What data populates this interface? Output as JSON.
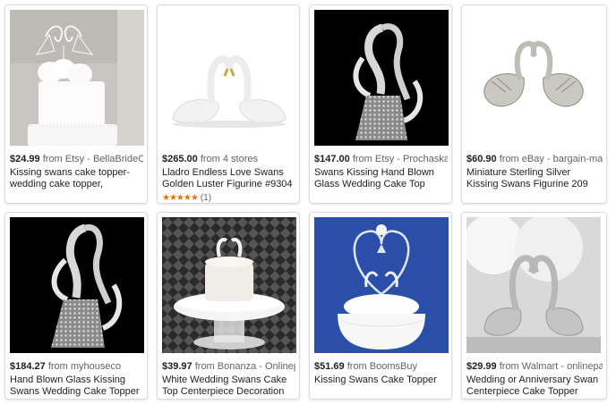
{
  "products": [
    {
      "price": "$24.99",
      "from": "from Etsy - BellaBrideCreations",
      "title": "Kissing swans cake topper- wedding cake topper, geometric wedding ...",
      "image": "cake-with-swan-topper-image"
    },
    {
      "price": "$265.00",
      "from": "from 4 stores",
      "title": "Lladro Endless Love Swans Golden Luster Figurine #9304",
      "stars": "★★★★★",
      "rating_count": "(1)",
      "image": "porcelain-swans-figurine-image"
    },
    {
      "price": "$147.00",
      "from": "from Etsy - ProchaskaGallery",
      "title": "Swans Kissing Hand Blown Glass Wedding Cake Top Topper",
      "image": "glass-swans-topper-image"
    },
    {
      "price": "$60.90",
      "from": "from eBay - bargain-market",
      "title": "Miniature Sterling Silver Kissing Swans Figurine 209",
      "image": "silver-swans-figurine-image"
    },
    {
      "price": "$184.27",
      "from": "from myhouseco",
      "title": "Hand Blown Glass Kissing Swans Wedding Cake Topper",
      "image": "glass-swans-topper-image"
    },
    {
      "price": "$39.97",
      "from": "from Bonanza - Onlinepartycenter",
      "title": "White Wedding Swans Cake Top Centerpiece Decoration Keepsake",
      "image": "swans-centerpiece-image"
    },
    {
      "price": "$51.69",
      "from": "from BoomsBuy",
      "title": "Kissing Swans Cake Topper",
      "image": "heart-swans-topper-image"
    },
    {
      "price": "$29.99",
      "from": "from Walmart - onlinepartycenter",
      "title": "Wedding or Anniversary Swan Centerpiece Cake Topper Decoration, White",
      "image": "silver-swans-centerpiece-image"
    }
  ]
}
